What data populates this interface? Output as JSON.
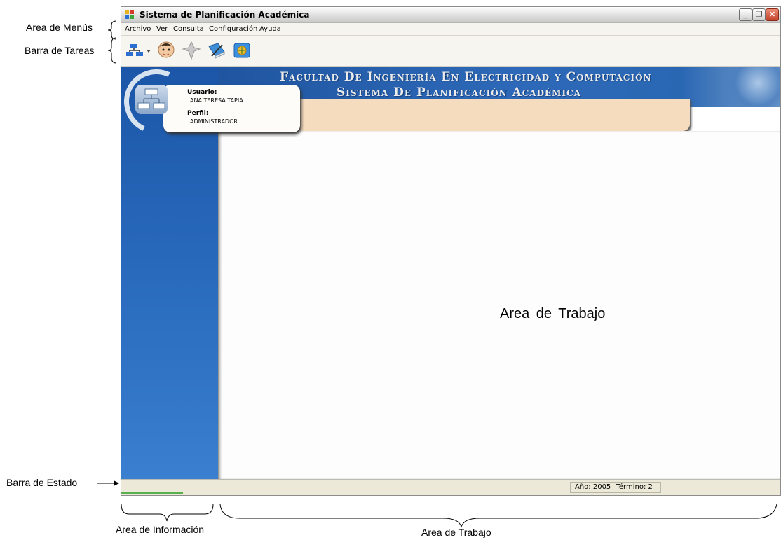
{
  "annotations": {
    "menus": "Area de Menús",
    "tasks": "Barra de Tareas",
    "status": "Barra de Estado",
    "info": "Area de Información",
    "work_bottom": "Area de Trabajo"
  },
  "window": {
    "title": "Sistema de Planificación Académica",
    "buttons": {
      "minimize": "_",
      "restore": "❐",
      "close": "✕"
    }
  },
  "menu": [
    "Archivo",
    "Ver",
    "Consulta",
    "Configuración",
    "Ayuda"
  ],
  "toolbar": {
    "icons": [
      "network-icon",
      "user-icon",
      "pin-icon",
      "book-pen-icon",
      "browser-icon"
    ]
  },
  "banner": {
    "line1": "Facultad De Ingeniería En Electricidad y Computación",
    "line2": "Sistema De Planificación Académica"
  },
  "user_card": {
    "user_label": "Usuario:",
    "user_value": "ANA TERESA TAPIA",
    "profile_label": "Perfil:",
    "profile_value": "ADMINISTRADOR"
  },
  "work_area": {
    "label": "Area de Trabajo"
  },
  "status": {
    "year": "Año: 2005",
    "term": "Término: 2"
  }
}
